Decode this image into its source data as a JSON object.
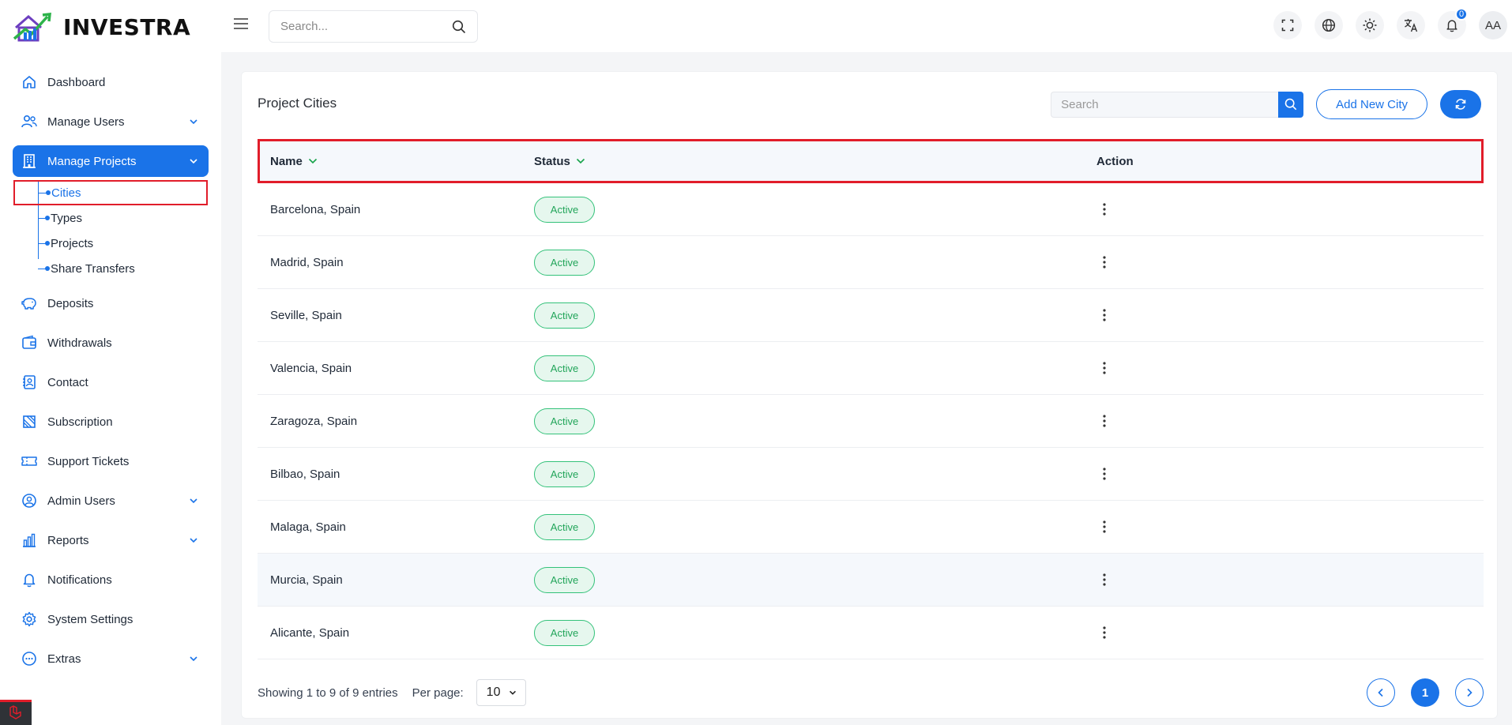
{
  "app": {
    "name": "INVESTRA"
  },
  "colors": {
    "primary": "#1a73e8",
    "active_green": "#22a55a",
    "highlight_red": "#e11d2a"
  },
  "sidebar": {
    "items": [
      {
        "label": "Dashboard",
        "icon": "home-icon"
      },
      {
        "label": "Manage Users",
        "icon": "users-icon",
        "expandable": true
      },
      {
        "label": "Manage Projects",
        "icon": "building-icon",
        "expandable": true,
        "active": true,
        "children": [
          {
            "label": "Cities",
            "current": true
          },
          {
            "label": "Types"
          },
          {
            "label": "Projects"
          },
          {
            "label": "Share Transfers"
          }
        ]
      },
      {
        "label": "Deposits",
        "icon": "piggy-bank-icon"
      },
      {
        "label": "Withdrawals",
        "icon": "wallet-icon"
      },
      {
        "label": "Contact",
        "icon": "contact-icon"
      },
      {
        "label": "Subscription",
        "icon": "subscription-icon"
      },
      {
        "label": "Support Tickets",
        "icon": "ticket-icon"
      },
      {
        "label": "Admin Users",
        "icon": "admin-user-icon",
        "expandable": true
      },
      {
        "label": "Reports",
        "icon": "bar-chart-icon",
        "expandable": true
      },
      {
        "label": "Notifications",
        "icon": "bell-icon"
      },
      {
        "label": "System Settings",
        "icon": "gear-icon"
      },
      {
        "label": "Extras",
        "icon": "dots-circle-icon",
        "expandable": true
      }
    ]
  },
  "topbar": {
    "search_placeholder": "Search...",
    "notification_count": "0",
    "avatar_initials": "AA"
  },
  "page": {
    "title": "Project Cities",
    "search_placeholder": "Search",
    "add_button": "Add New City"
  },
  "table": {
    "columns": {
      "name": "Name",
      "status": "Status",
      "action": "Action"
    },
    "rows": [
      {
        "name": "Barcelona, Spain",
        "status": "Active"
      },
      {
        "name": "Madrid, Spain",
        "status": "Active"
      },
      {
        "name": "Seville, Spain",
        "status": "Active"
      },
      {
        "name": "Valencia, Spain",
        "status": "Active"
      },
      {
        "name": "Zaragoza, Spain",
        "status": "Active"
      },
      {
        "name": "Bilbao, Spain",
        "status": "Active"
      },
      {
        "name": "Malaga, Spain",
        "status": "Active"
      },
      {
        "name": "Murcia, Spain",
        "status": "Active",
        "hovered": true
      },
      {
        "name": "Alicante, Spain",
        "status": "Active"
      }
    ]
  },
  "footer": {
    "showing": "Showing 1 to 9 of 9 entries",
    "per_page_label": "Per page:",
    "per_page_value": "10",
    "current_page": "1"
  }
}
